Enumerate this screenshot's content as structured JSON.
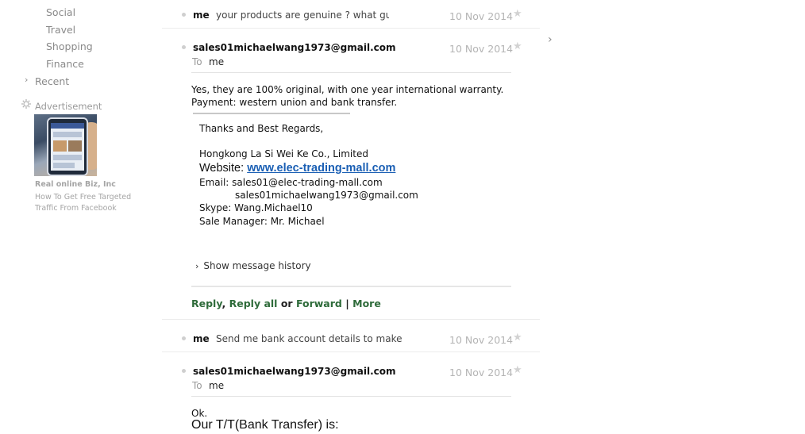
{
  "sidebar": {
    "items": [
      "Social",
      "Travel",
      "Shopping",
      "Finance"
    ],
    "recent_label": "Recent",
    "advertisement_label": "Advertisement",
    "ad": {
      "title": "Real online Biz, Inc",
      "description": "How To Get Free Targeted Traffic From Facebook"
    }
  },
  "thread": {
    "messages": [
      {
        "sender": "me",
        "snippet": "your products are genuine ? what guara",
        "date": "10 Nov 2014"
      },
      {
        "sender": "sales01michaelwang1973@gmail.com",
        "to_label": "To",
        "to": "me",
        "date": "10 Nov 2014",
        "body_line1": "Yes, they are 100% original, with one year international warranty.",
        "body_line2": "Payment: western union and bank transfer.",
        "signature": {
          "regards": "Thanks and Best Regards,",
          "company": "Hongkong La Si Wei Ke Co., Limited",
          "website_label": "Website: ",
          "website": "www.elec-trading-mall.com",
          "email_line": "Email: sales01@elec-trading-mall.com",
          "email_alt": "sales01michaelwang1973@gmail.com",
          "skype": "Skype: Wang.Michael10",
          "manager": "Sale Manager: Mr. Michael"
        },
        "show_history": "Show message history",
        "actions": {
          "reply": "Reply",
          "reply_all": "Reply all",
          "or": "or",
          "forward": "Forward",
          "separator": "|",
          "more": "More"
        }
      },
      {
        "sender": "me",
        "snippet": "Send me bank account details to make",
        "date": "10 Nov 2014"
      },
      {
        "sender": "sales01michaelwang1973@gmail.com",
        "to_label": "To",
        "to": "me",
        "date": "10 Nov 2014",
        "body_line1": "Ok.",
        "body_line2": "Our T/T(Bank Transfer) is:"
      }
    ]
  },
  "icons": {
    "star": "star-icon",
    "chevron_right": "chevron-right-icon",
    "ad": "advertisement-icon"
  }
}
